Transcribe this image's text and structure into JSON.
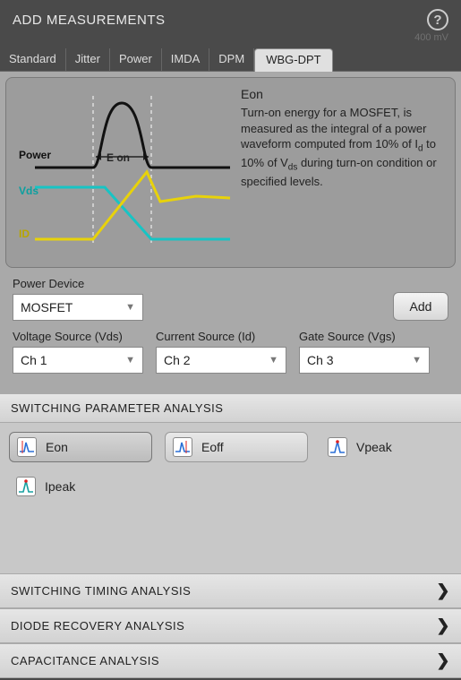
{
  "header": {
    "title": "ADD MEASUREMENTS",
    "watermark": "400 mV"
  },
  "tabs": {
    "items": [
      "Standard",
      "Jitter",
      "Power",
      "IMDA",
      "DPM",
      "WBG-DPT"
    ],
    "active": "WBG-DPT"
  },
  "preview": {
    "title": "Eon",
    "description_html": "Turn-on energy for a MOSFET, is measured as the integral of a power waveform computed from 10% of I<sub>d</sub> to 10% of V<sub>ds</sub> during turn-on condition or specified levels.",
    "labels": {
      "power": "Power",
      "vds": "Vds",
      "id": "ID",
      "eon_marker": "E on"
    }
  },
  "form": {
    "power_device": {
      "label": "Power Device",
      "value": "MOSFET"
    },
    "add_button": "Add",
    "voltage_source": {
      "label": "Voltage Source (Vds)",
      "value": "Ch 1"
    },
    "current_source": {
      "label": "Current Source (Id)",
      "value": "Ch 2"
    },
    "gate_source": {
      "label": "Gate Source (Vgs)",
      "value": "Ch 3"
    }
  },
  "sections": {
    "switching_param": {
      "title": "SWITCHING PARAMETER ANALYSIS",
      "items": [
        {
          "label": "Eon",
          "selected": true
        },
        {
          "label": "Eoff",
          "selected": false
        },
        {
          "label": "Vpeak",
          "selected": false
        },
        {
          "label": "Ipeak",
          "selected": false
        }
      ]
    },
    "switching_timing": {
      "title": "SWITCHING TIMING ANALYSIS"
    },
    "diode_recovery": {
      "title": "DIODE RECOVERY ANALYSIS"
    },
    "capacitance": {
      "title": "CAPACITANCE ANALYSIS"
    }
  },
  "icons": {
    "help": "?",
    "chevron_down": "▼",
    "chevron_right": "❯"
  }
}
